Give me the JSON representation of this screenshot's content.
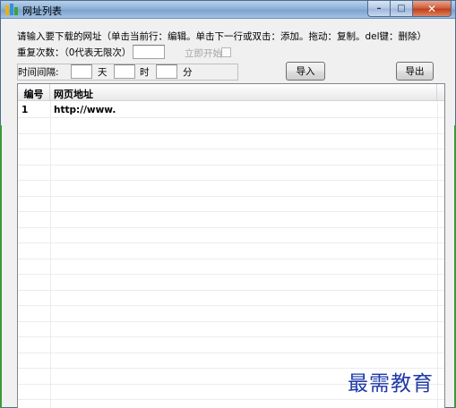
{
  "window": {
    "title": "网址列表",
    "buttons": {
      "minimize": "–",
      "maximize": "□",
      "close": "✕"
    }
  },
  "instruction": "请输入要下载的网址（单击当前行：编辑。单击下一行或双击：添加。拖动：复制。del键：删除）",
  "repeat": {
    "label": "重复次数：（0代表无限次）",
    "value": "",
    "start_now_label": "立即开始",
    "start_now_checked": false
  },
  "interval": {
    "label": "时间间隔:",
    "day_label": "天",
    "hour_label": "时",
    "minute_label": "分",
    "day_value": "",
    "hour_value": "",
    "minute_value": ""
  },
  "toolbar": {
    "import_label": "导入",
    "export_label": "导出"
  },
  "table": {
    "columns": [
      "编号",
      "网页地址"
    ],
    "rows": [
      [
        "1",
        "http://www."
      ]
    ]
  },
  "watermark": "最需教育"
}
